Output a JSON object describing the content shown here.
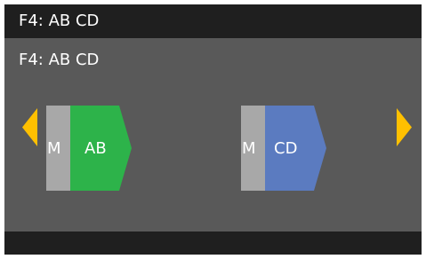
{
  "title": "F4: AB CD",
  "subtitle": "F4: AB CD",
  "colors": {
    "screen_background": "#595959",
    "bars": "#1f1f1f",
    "nav_arrow": "#ffc000",
    "m_segment": "#a8a8a8",
    "ab_block": "#2db34a",
    "cd_block": "#5b7bc0"
  },
  "blocks": [
    {
      "prefix": "M",
      "label": "AB"
    },
    {
      "prefix": "M",
      "label": "CD"
    }
  ],
  "navigation": {
    "left_icon": "chevron-left-icon",
    "right_icon": "chevron-right-icon"
  }
}
